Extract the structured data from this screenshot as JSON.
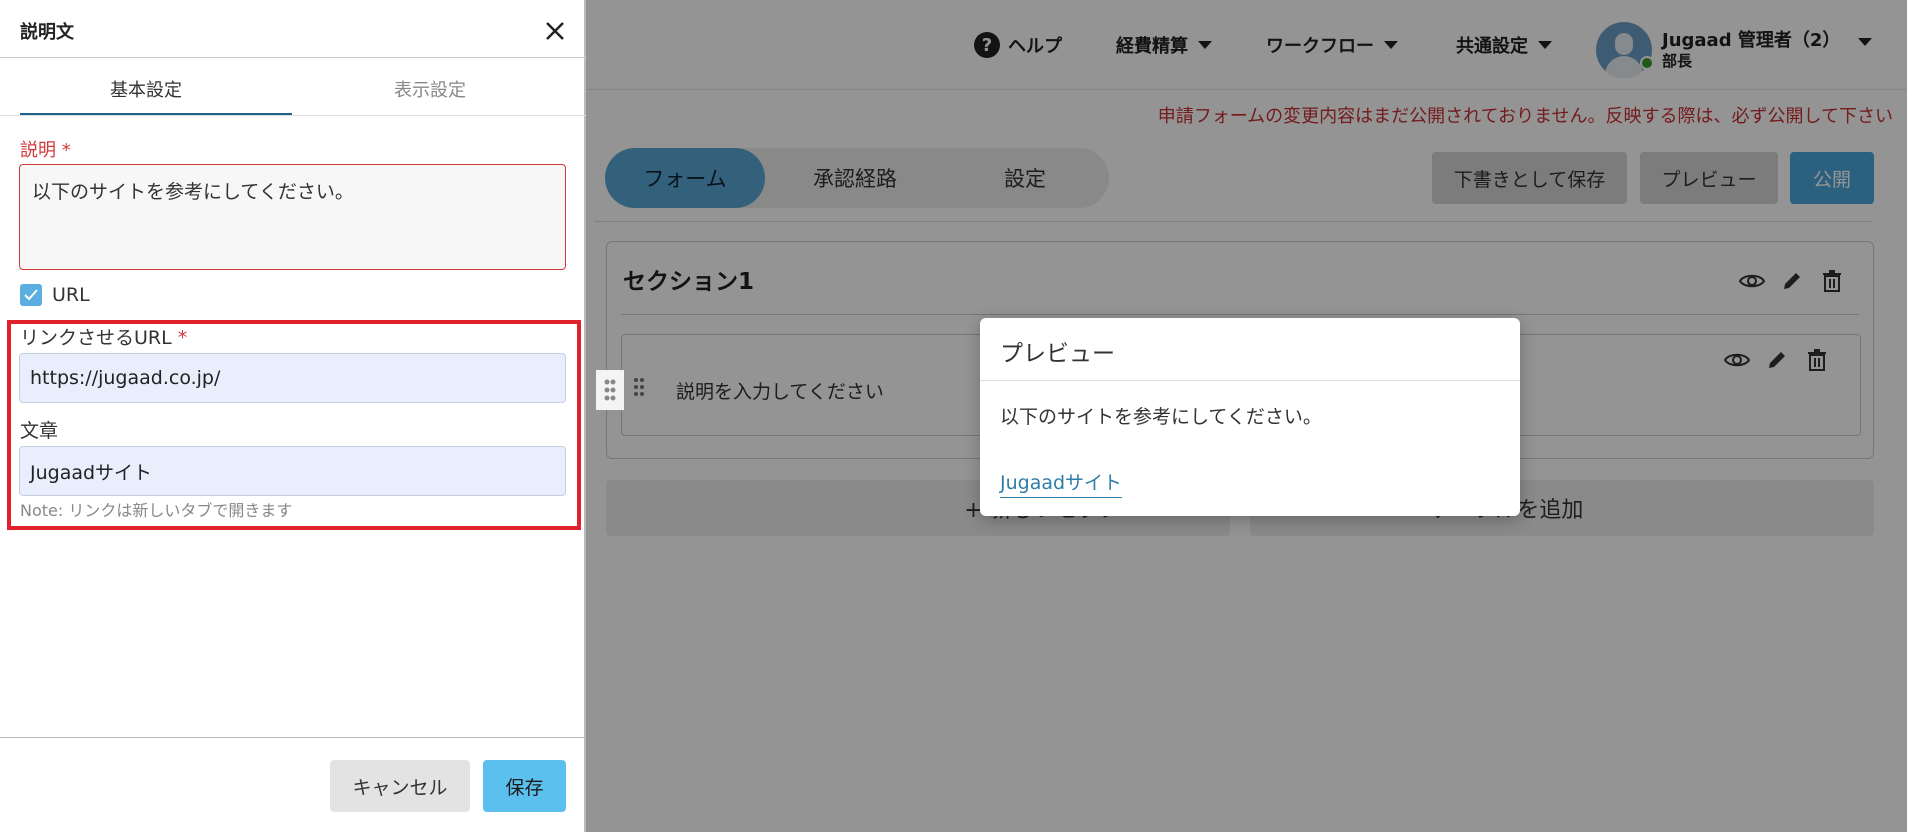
{
  "header": {
    "help_label": "ヘルプ",
    "nav": [
      "経費精算",
      "ワークフロー",
      "共通設定"
    ],
    "user_name": "Jugaad 管理者（2）",
    "user_role": "部長"
  },
  "warning": "申請フォームの変更内容はまだ公開されておりません。反映する際は、必ず公開して下さい",
  "steps": [
    "フォーム",
    "承認経路",
    "設定"
  ],
  "actions": {
    "draft": "下書きとして保存",
    "preview": "プレビュー",
    "publish": "公開"
  },
  "section": {
    "title": "セクション1",
    "field_placeholder": "説明を入力してください",
    "add_section": "+ 新しいセクシ",
    "add_table": "テーブルを追加"
  },
  "preview_dialog": {
    "title": "プレビュー",
    "body": "以下のサイトを参考にしてください。",
    "link_text": "Jugaadサイト"
  },
  "panel": {
    "title": "説明文",
    "tabs": [
      "基本設定",
      "表示設定"
    ],
    "active_tab": "基本設定",
    "desc_label": "説明",
    "desc_required_mark": "*",
    "desc_value": "以下のサイトを参考にしてください。",
    "url_checkbox_label": "URL",
    "url_checked": true,
    "link_url_label": "リンクさせるURL",
    "link_url_required_mark": "*",
    "link_url_value": "https://jugaad.co.jp/",
    "link_text_label": "文章",
    "link_text_value": "Jugaadサイト",
    "note": "Note: リンクは新しいタブで開きます",
    "cancel": "キャンセル",
    "save": "保存"
  },
  "colors": {
    "accent": "#4aa5d9",
    "warning": "#c83030",
    "required": "#d03a3a",
    "highlight": "#e0212b",
    "link": "#2e7fa8"
  }
}
